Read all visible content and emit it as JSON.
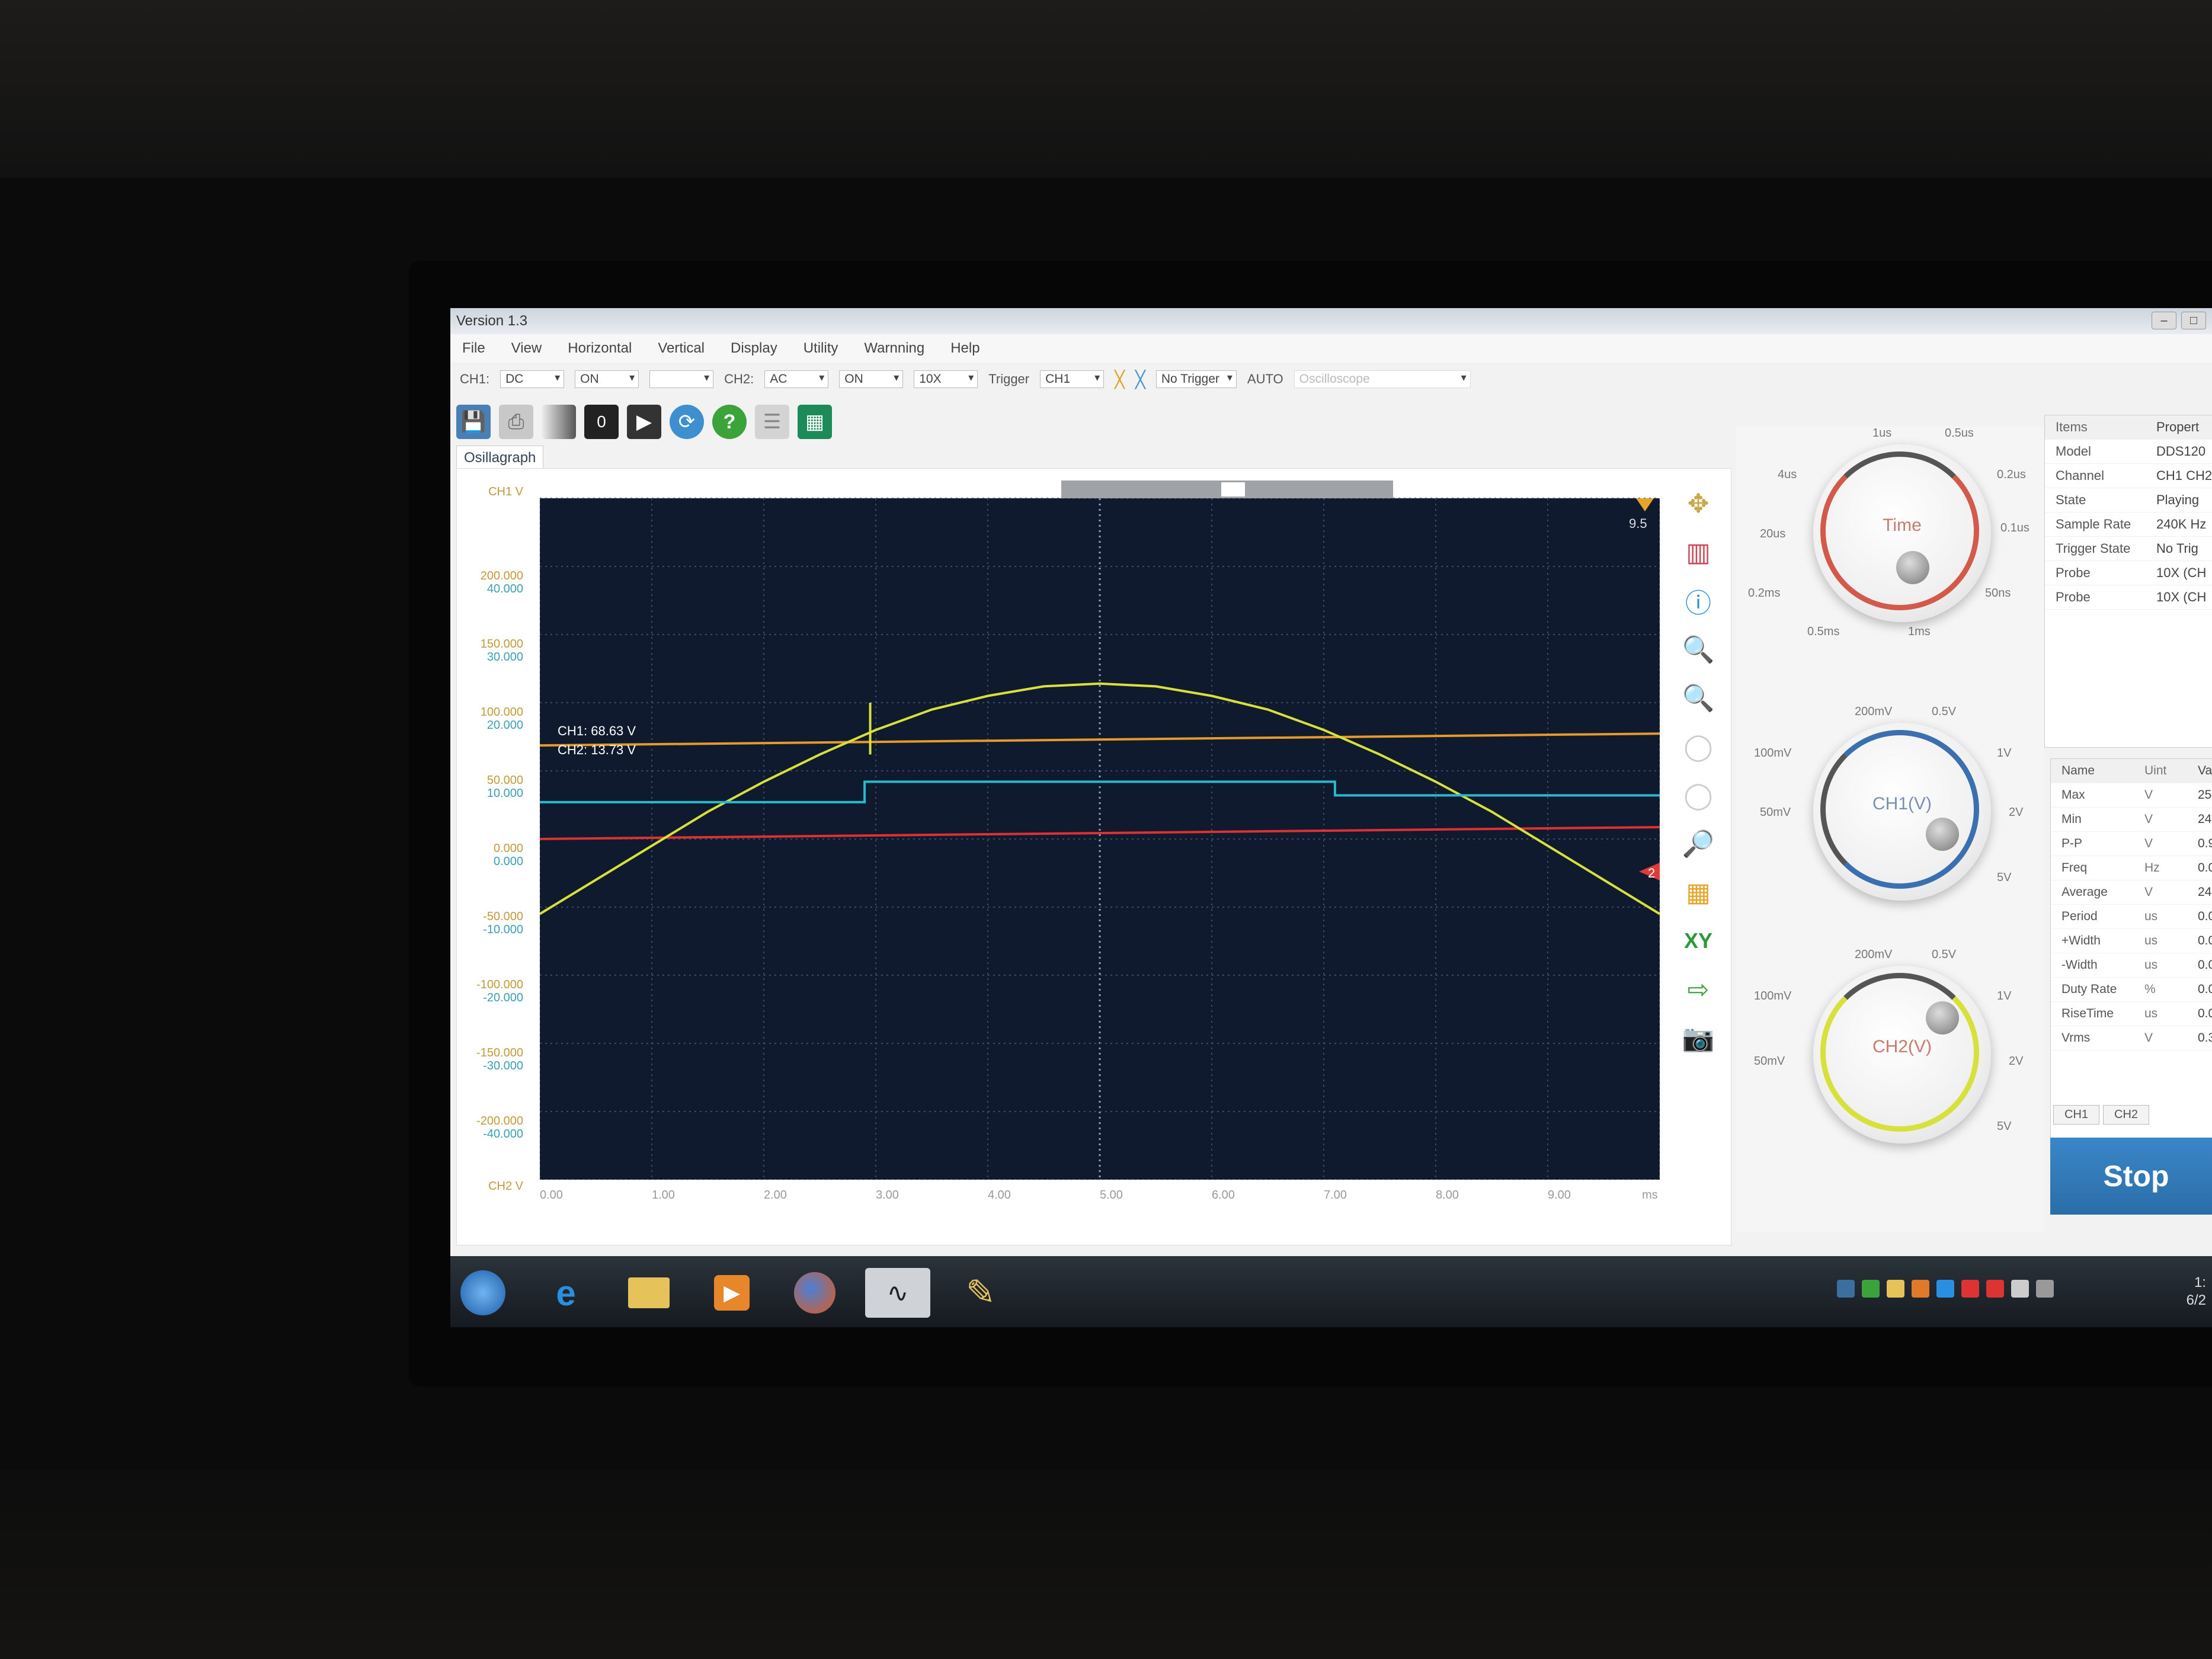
{
  "window": {
    "title": "Version 1.3"
  },
  "menu": [
    "File",
    "View",
    "Horizontal",
    "Vertical",
    "Display",
    "Utility",
    "Warnning",
    "Help"
  ],
  "channels": {
    "ch1_label": "CH1:",
    "ch1_coupling": "DC",
    "ch1_state": "ON",
    "ch2_label": "CH2:",
    "ch2_coupling": "AC",
    "ch2_state": "ON",
    "ch2_probe": "10X",
    "trigger_label": "Trigger",
    "trigger_source": "CH1",
    "trigger_mode": "No Trigger",
    "auto_label": "AUTO",
    "device": "Oscilloscope"
  },
  "tabs": {
    "active": "Osillagraph"
  },
  "scope": {
    "ch1_units": "CH1 V",
    "ch2_units": "CH2 V",
    "y_labels": [
      {
        "a": "200.000",
        "b": "40.000"
      },
      {
        "a": "150.000",
        "b": "30.000"
      },
      {
        "a": "100.000",
        "b": "20.000"
      },
      {
        "a": "50.000",
        "b": "10.000"
      },
      {
        "a": "0.000",
        "b": "0.000"
      },
      {
        "a": "-50.000",
        "b": "-10.000"
      },
      {
        "a": "-100.000",
        "b": "-20.000"
      },
      {
        "a": "-150.000",
        "b": "-30.000"
      },
      {
        "a": "-200.000",
        "b": "-40.000"
      }
    ],
    "x_labels": [
      "0.00",
      "1.00",
      "2.00",
      "3.00",
      "4.00",
      "5.00",
      "6.00",
      "7.00",
      "8.00",
      "9.00"
    ],
    "x_unit": "ms",
    "ch1_cursor": "CH1: 68.63 V",
    "ch2_cursor": "CH2: 13.73 V",
    "top_marker": "9.5",
    "ch2_marker": "2"
  },
  "chart_data": {
    "type": "line",
    "x_unit": "ms",
    "xlim": [
      0,
      10
    ],
    "ch1_ylim": [
      -250,
      250
    ],
    "series": [
      {
        "name": "CH1",
        "color": "#d8e03a",
        "x": [
          0,
          0.5,
          1,
          1.5,
          2,
          2.5,
          3,
          3.5,
          4,
          4.5,
          5,
          5.5,
          6,
          6.5,
          7,
          7.5,
          8,
          8.5,
          9,
          9.5,
          10
        ],
        "y": [
          -55,
          -30,
          -5,
          20,
          42,
          62,
          80,
          95,
          105,
          112,
          114,
          112,
          105,
          95,
          80,
          62,
          42,
          20,
          -5,
          -30,
          -55
        ]
      },
      {
        "name": "CH2",
        "color": "#2ab8cf",
        "x": [
          0,
          2.9,
          2.9,
          7.1,
          7.1,
          10
        ],
        "y": [
          27,
          27,
          42,
          42,
          32,
          32
        ]
      }
    ],
    "cursors": [
      {
        "color": "#e59a2a",
        "y": 68.63
      },
      {
        "color": "#e03030",
        "y": 0
      }
    ],
    "spike": {
      "x": 2.95,
      "from": 62,
      "to": 100
    }
  },
  "knobs": {
    "time": {
      "label": "Time",
      "ticks": [
        "1us",
        "0.5us",
        "0.2us",
        "0.1us",
        "4us",
        "20us",
        "0.2ms",
        "0.5ms",
        "1ms",
        "50ns"
      ],
      "value": "1ms",
      "color": "#d35a4a"
    },
    "ch1": {
      "label": "CH1(V)",
      "ticks": [
        "200mV",
        "0.5V",
        "100mV",
        "1V",
        "50mV",
        "2V",
        "5V"
      ],
      "color": "#3a6fb0"
    },
    "ch2": {
      "label": "CH2(V)",
      "ticks": [
        "200mV",
        "0.5V",
        "100mV",
        "1V",
        "50mV",
        "2V",
        "5V"
      ],
      "color": "#d8e03a"
    }
  },
  "properties": {
    "head": [
      "Items",
      "Propert"
    ],
    "rows": [
      [
        "Model",
        "DDS120"
      ],
      [
        "Channel",
        "CH1 CH2"
      ],
      [
        "State",
        "Playing"
      ],
      [
        "Sample Rate",
        "240K Hz"
      ],
      [
        "Trigger State",
        "No Trig"
      ],
      [
        "Probe",
        "10X (CH"
      ],
      [
        "Probe",
        "10X (CH"
      ]
    ]
  },
  "measurements": {
    "head": [
      "Name",
      "Uint",
      "Val"
    ],
    "rows": [
      [
        "Max",
        "V",
        "25."
      ],
      [
        "Min",
        "V",
        "24."
      ],
      [
        "P-P",
        "V",
        "0.9"
      ],
      [
        "Freq",
        "Hz",
        "0.0"
      ],
      [
        "Average",
        "V",
        "24."
      ],
      [
        "Period",
        "us",
        "0.0"
      ],
      [
        "+Width",
        "us",
        "0.0"
      ],
      [
        "-Width",
        "us",
        "0.0"
      ],
      [
        "Duty Rate",
        "%",
        "0.0"
      ],
      [
        "RiseTime",
        "us",
        "0.0"
      ],
      [
        "Vrms",
        "V",
        "0.3"
      ]
    ],
    "tabs": [
      "CH1",
      "CH2"
    ]
  },
  "stop_button": "Stop",
  "clock": {
    "time": "1:",
    "date": "6/2"
  }
}
